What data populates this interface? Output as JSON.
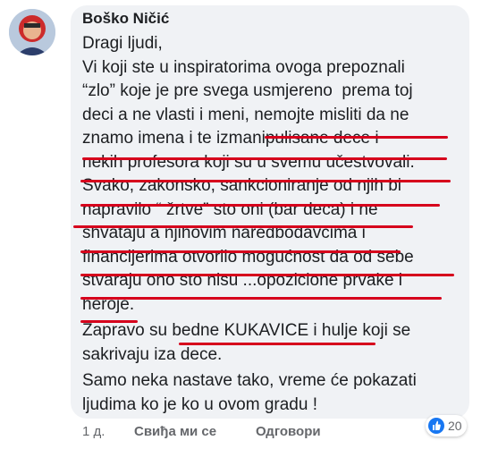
{
  "comment": {
    "author": "Boško Ničić",
    "lines": [
      "Dragi ljudi,",
      "Vi koji ste u inspiratorima ovoga prepoznali",
      "“zlo” koje je pre svega usmjereno  prema toj",
      "deci a ne vlasti i meni, nemojte misliti da ne",
      "znamo imena i te izmanipulisane dece i",
      "nekih profesora koji su u svemu učestvovali.",
      "Svako, zakonsko, sankcioniranje od njih bi",
      "napravilo “ žrtve” sto oni (bar deca) i ne",
      "shvataju a njihovim naredbodavcima i",
      "financijerima otvorilo mogućnost da od sebe",
      "stvaraju ono sto nisu ...opozicione prvake i",
      "heroje.",
      "Zapravo su bedne KUKAVICE i hulje koji se",
      "sakrivaju iza dece.",
      "Samo neka nastave tako, vreme će pokazati",
      "ljudima ko je ko u ovom gradu !"
    ]
  },
  "footer": {
    "time": "1 д.",
    "like_label": "Свиђа ми се",
    "reply_label": "Одговори"
  },
  "reactions": {
    "icon": "like-icon",
    "count": "20"
  },
  "colors": {
    "underline": "#d6001c",
    "bubble": "#f0f2f5",
    "like_blue": "#1877f2"
  }
}
